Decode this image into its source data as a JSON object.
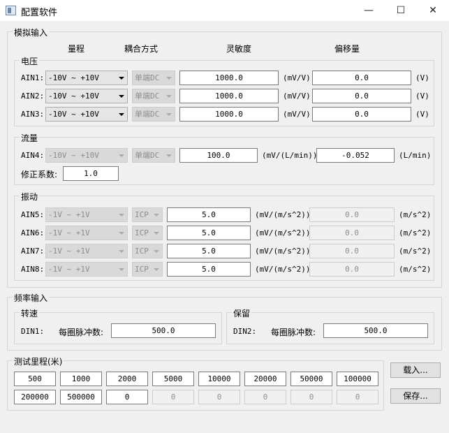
{
  "window": {
    "title": "配置软件",
    "minimize": "—",
    "maximize": "☐",
    "close": "✕"
  },
  "analog": {
    "legend": "模拟输入",
    "headers": {
      "range": "量程",
      "coupling": "耦合方式",
      "sensitivity": "灵敏度",
      "offset": "偏移量"
    },
    "voltage": {
      "legend": "电压",
      "rows": [
        {
          "label": "AIN1:",
          "range": "-10V ~ +10V",
          "coupling": "单端DC",
          "sensitivity": "1000.0",
          "sens_unit": "(mV/V)",
          "offset": "0.0",
          "offset_unit": "(V)"
        },
        {
          "label": "AIN2:",
          "range": "-10V ~ +10V",
          "coupling": "单端DC",
          "sensitivity": "1000.0",
          "sens_unit": "(mV/V)",
          "offset": "0.0",
          "offset_unit": "(V)"
        },
        {
          "label": "AIN3:",
          "range": "-10V ~ +10V",
          "coupling": "单端DC",
          "sensitivity": "1000.0",
          "sens_unit": "(mV/V)",
          "offset": "0.0",
          "offset_unit": "(V)"
        }
      ]
    },
    "flow": {
      "legend": "流量",
      "row": {
        "label": "AIN4:",
        "range": "-10V ~ +10V",
        "coupling": "单端DC",
        "sensitivity": "100.0",
        "sens_unit": "(mV/(L/min))",
        "offset": "-0.052",
        "offset_unit": "(L/min)"
      },
      "correction_label": "修正系数:",
      "correction_value": "1.0"
    },
    "vibration": {
      "legend": "振动",
      "rows": [
        {
          "label": "AIN5:",
          "range": "-1V ~ +1V",
          "coupling": "ICP",
          "sensitivity": "5.0",
          "sens_unit": "(mV/(m/s^2))",
          "offset": "0.0",
          "offset_unit": "(m/s^2)"
        },
        {
          "label": "AIN6:",
          "range": "-1V ~ +1V",
          "coupling": "ICP",
          "sensitivity": "5.0",
          "sens_unit": "(mV/(m/s^2))",
          "offset": "0.0",
          "offset_unit": "(m/s^2)"
        },
        {
          "label": "AIN7:",
          "range": "-1V ~ +1V",
          "coupling": "ICP",
          "sensitivity": "5.0",
          "sens_unit": "(mV/(m/s^2))",
          "offset": "0.0",
          "offset_unit": "(m/s^2)"
        },
        {
          "label": "AIN8:",
          "range": "-1V ~ +1V",
          "coupling": "ICP",
          "sensitivity": "5.0",
          "sens_unit": "(mV/(m/s^2))",
          "offset": "0.0",
          "offset_unit": "(m/s^2)"
        }
      ]
    }
  },
  "frequency": {
    "legend": "频率输入",
    "speed": {
      "legend": "转速",
      "channel": "DIN1:",
      "label": "每圈脉冲数:",
      "value": "500.0"
    },
    "retain": {
      "legend": "保留",
      "channel": "DIN2:",
      "label": "每圈脉冲数:",
      "value": "500.0"
    }
  },
  "mileage": {
    "legend": "测试里程(米)",
    "row1": [
      "500",
      "1000",
      "2000",
      "5000",
      "10000",
      "20000",
      "50000",
      "100000"
    ],
    "row2": [
      "200000",
      "500000",
      "0",
      "0",
      "0",
      "0",
      "0",
      "0"
    ],
    "load_button": "载入...",
    "save_button": "保存..."
  }
}
